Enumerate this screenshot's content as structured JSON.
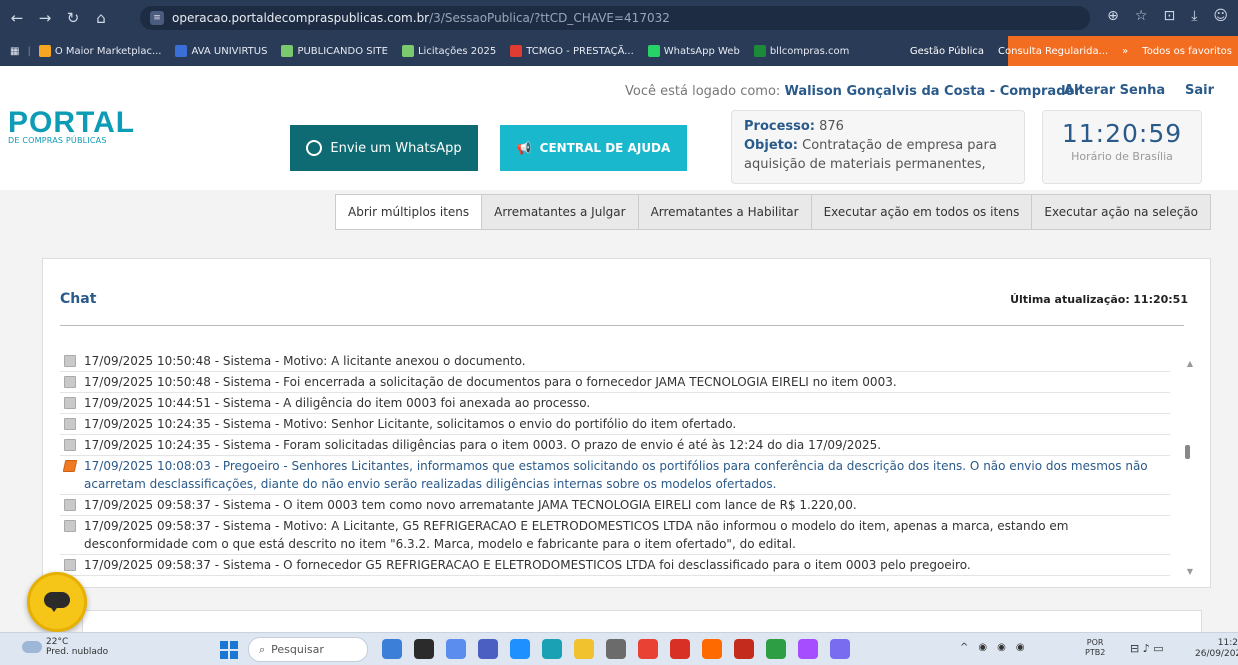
{
  "browser": {
    "url_host": "operacao.portaldecompraspublicas.com.br",
    "url_path": "/3/SessaoPublica/?ttCD_CHAVE=417032",
    "bookmarks": [
      {
        "label": "O Maior Marketplac...",
        "color": "#f5a623"
      },
      {
        "label": "AVA UNIVIRTUS",
        "color": "#3a6fd8"
      },
      {
        "label": "PUBLICANDO SITE",
        "color": "#7bc96f"
      },
      {
        "label": "Licitações 2025",
        "color": "#7bc96f"
      },
      {
        "label": "TCMGO - PRESTAÇÃ...",
        "color": "#e03c31"
      },
      {
        "label": "WhatsApp Web",
        "color": "#25d366"
      },
      {
        "label": "bllcompras.com",
        "color": "#1d8a3a"
      }
    ],
    "bookmarks_right": [
      "Gestão Pública",
      "Consulta Regularida...",
      "»",
      "Todos os favoritos"
    ]
  },
  "header": {
    "logged_prefix": "Você está logado como:",
    "logged_user": "Walison Gonçalvis da Costa - Comprador",
    "change_password": "Alterar Senha",
    "logout": "Sair",
    "logo_main": "PORTAL",
    "logo_sub": "DE COMPRAS PÚBLICAS",
    "whatsapp_button": "Envie um WhatsApp",
    "help_button": "CENTRAL DE AJUDA",
    "process_label": "Processo:",
    "process_number": "876",
    "object_label": "Objeto:",
    "object_text": "Contratação de empresa para aquisição de materiais permanentes,",
    "clock_time": "11:20:59",
    "clock_label": "Horário de Brasília"
  },
  "actions": [
    "Abrir múltiplos itens",
    "Arrematantes a Julgar",
    "Arrematantes a Habilitar",
    "Executar ação em todos os itens",
    "Executar ação na seleção"
  ],
  "chat": {
    "title": "Chat",
    "updated_label": "Última atualização:",
    "updated_time": "11:20:51",
    "messages": [
      {
        "type": "sistema",
        "text": "17/09/2025 10:50:48 - Sistema - Motivo: A licitante anexou o documento."
      },
      {
        "type": "sistema",
        "text": "17/09/2025 10:50:48 - Sistema - Foi encerrada a solicitação de documentos para o fornecedor JAMA TECNOLOGIA EIRELI no item 0003."
      },
      {
        "type": "sistema",
        "text": "17/09/2025 10:44:51 - Sistema - A diligência do item 0003 foi anexada ao processo."
      },
      {
        "type": "sistema",
        "text": "17/09/2025 10:24:35 - Sistema - Motivo: Senhor Licitante, solicitamos o envio do portifólio do item ofertado."
      },
      {
        "type": "sistema",
        "text": "17/09/2025 10:24:35 - Sistema - Foram solicitadas diligências para o item 0003. O prazo de envio é até às 12:24 do dia 17/09/2025."
      },
      {
        "type": "pregoeiro",
        "text": "17/09/2025 10:08:03 - Pregoeiro - Senhores Licitantes, informamos que estamos solicitando os portifólios para conferência da descrição dos itens. O não envio dos mesmos não acarretam desclassificações, diante do não envio serão realizadas diligências internas sobre os modelos ofertados."
      },
      {
        "type": "sistema",
        "text": "17/09/2025 09:58:37 - Sistema - O item 0003 tem como novo arrematante JAMA TECNOLOGIA EIRELI com lance de R$ 1.220,00."
      },
      {
        "type": "sistema",
        "text": "17/09/2025 09:58:37 - Sistema - Motivo: A Licitante, G5 REFRIGERACAO E ELETRODOMESTICOS LTDA não informou o modelo do item, apenas a marca, estando em desconformidade com o que está descrito no item \"6.3.2. Marca, modelo e fabricante para o item ofertado\", do edital."
      },
      {
        "type": "sistema",
        "text": "17/09/2025 09:58:37 - Sistema - O fornecedor G5 REFRIGERACAO E ELETRODOMESTICOS LTDA foi desclassificado para o item 0003 pelo pregoeiro."
      }
    ]
  },
  "taskbar": {
    "temp": "22°C",
    "weather": "Pred. nublado",
    "search": "Pesquisar",
    "lang1": "POR",
    "lang2": "PTB2",
    "time": "11:2",
    "date": "26/09/202",
    "app_colors": [
      "#3b7fd9",
      "#2b2b2b",
      "#5b8def",
      "#4a5fc1",
      "#1e90ff",
      "#1aa1b3",
      "#f2c12e",
      "#6b6b6b",
      "#e94235",
      "#d93025",
      "#ff6a00",
      "#c42b1c",
      "#2e9e44",
      "#a64dff",
      "#7a6cf0"
    ]
  }
}
